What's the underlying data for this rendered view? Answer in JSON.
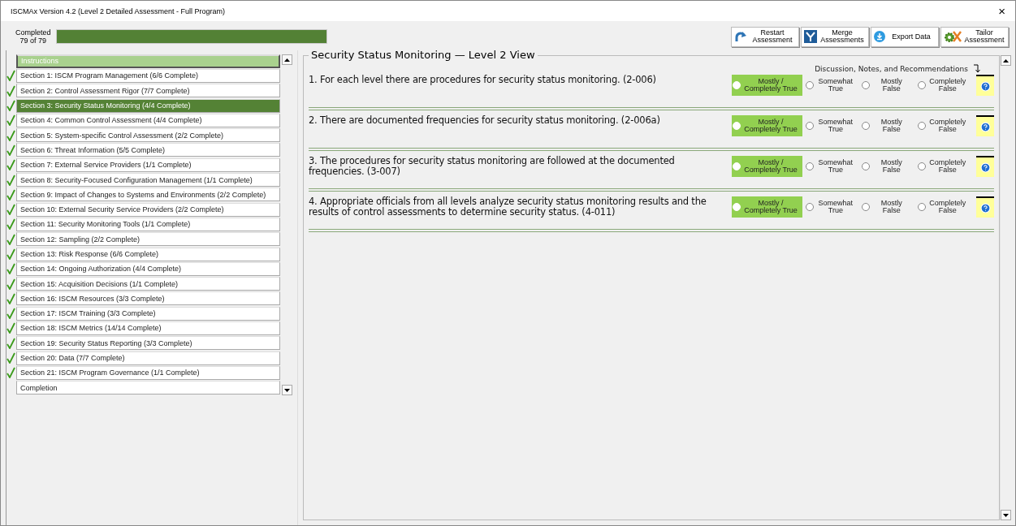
{
  "window": {
    "title": "ISCMAx Version 4.2 (Level 2 Detailed Assessment - Full Program)",
    "close": "×"
  },
  "progress": {
    "label": "Completed",
    "count": "79 of 79",
    "level": 1
  },
  "toolbar": [
    {
      "label": "Restart Assessment",
      "kind": "restart"
    },
    {
      "label": "Merge Assessments",
      "kind": "merge"
    },
    {
      "label": "Export Data",
      "kind": "export"
    },
    {
      "label": "Tailor Assessment",
      "kind": "tailor"
    }
  ],
  "sidebar": {
    "items": [
      {
        "label": "Instructions",
        "checked": false,
        "selected": false,
        "focused": true
      },
      {
        "label": "Section 1: ISCM Program Management (6/6 Complete)",
        "checked": true,
        "selected": false,
        "focused": false
      },
      {
        "label": "Section 2: Control Assessment Rigor (7/7 Complete)",
        "checked": true,
        "selected": false,
        "focused": false
      },
      {
        "label": "Section 3: Security Status Monitoring (4/4 Complete)",
        "checked": true,
        "selected": true,
        "focused": false
      },
      {
        "label": "Section 4: Common Control Assessment (4/4 Complete)",
        "checked": true,
        "selected": false,
        "focused": false
      },
      {
        "label": "Section 5: System-specific Control Assessment (2/2 Complete)",
        "checked": true,
        "selected": false,
        "focused": false
      },
      {
        "label": "Section 6: Threat Information (5/5 Complete)",
        "checked": true,
        "selected": false,
        "focused": false
      },
      {
        "label": "Section 7: External Service Providers (1/1 Complete)",
        "checked": true,
        "selected": false,
        "focused": false
      },
      {
        "label": "Section 8: Security-Focused Configuration Management (1/1 Complete)",
        "checked": true,
        "selected": false,
        "focused": false
      },
      {
        "label": "Section 9: Impact of Changes to Systems and Environments (2/2 Complete)",
        "checked": true,
        "selected": false,
        "focused": false
      },
      {
        "label": "Section 10: External Security Service Providers (2/2 Complete)",
        "checked": true,
        "selected": false,
        "focused": false
      },
      {
        "label": "Section 11: Security Monitoring Tools (1/1 Complete)",
        "checked": true,
        "selected": false,
        "focused": false
      },
      {
        "label": "Section 12: Sampling (2/2 Complete)",
        "checked": true,
        "selected": false,
        "focused": false
      },
      {
        "label": "Section 13: Risk Response (6/6 Complete)",
        "checked": true,
        "selected": false,
        "focused": false
      },
      {
        "label": "Section 14: Ongoing Authorization (4/4 Complete)",
        "checked": true,
        "selected": false,
        "focused": false
      },
      {
        "label": "Section 15: Acquisition Decisions (1/1 Complete)",
        "checked": true,
        "selected": false,
        "focused": false
      },
      {
        "label": "Section 16: ISCM Resources (3/3 Complete)",
        "checked": true,
        "selected": false,
        "focused": false
      },
      {
        "label": "Section 17: ISCM Training (3/3 Complete)",
        "checked": true,
        "selected": false,
        "focused": false
      },
      {
        "label": "Section 18: ISCM Metrics (14/14 Complete)",
        "checked": true,
        "selected": false,
        "focused": false
      },
      {
        "label": "Section 19: Security Status Reporting (3/3 Complete)",
        "checked": true,
        "selected": false,
        "focused": false
      },
      {
        "label": "Section 20: Data (7/7 Complete)",
        "checked": true,
        "selected": false,
        "focused": false
      },
      {
        "label": "Section 21: ISCM Program Governance (1/1 Complete)",
        "checked": true,
        "selected": false,
        "focused": false
      },
      {
        "label": "Completion",
        "checked": false,
        "selected": false,
        "focused": false
      }
    ]
  },
  "main": {
    "title": "Security Status Monitoring — Level 2 View",
    "notes_header": "Discussion, Notes, and Recommendations",
    "questions": [
      {
        "text": "1. For each level there are procedures for security status monitoring. (2-006)",
        "options": [
          {
            "label": "Mostly / Completely True",
            "selected": true
          },
          {
            "label": "Somewhat True",
            "selected": false
          },
          {
            "label": "Mostly False",
            "selected": false
          },
          {
            "label": "Completely False",
            "selected": false
          }
        ]
      },
      {
        "text": "2. There are documented frequencies for security status monitoring. (2-006a)",
        "options": [
          {
            "label": "Mostly / Completely True",
            "selected": true
          },
          {
            "label": "Somewhat True",
            "selected": false
          },
          {
            "label": "Mostly False",
            "selected": false
          },
          {
            "label": "Completely False",
            "selected": false
          }
        ]
      },
      {
        "text": "3. The procedures for security status monitoring are followed at the documented frequencies. (3-007)",
        "options": [
          {
            "label": "Mostly / Completely True",
            "selected": true
          },
          {
            "label": "Somewhat True",
            "selected": false
          },
          {
            "label": "Mostly False",
            "selected": false
          },
          {
            "label": "Completely False",
            "selected": false
          }
        ]
      },
      {
        "text": "4. Appropriate officials from all levels analyze security status monitoring results and the results of control assessments to determine security status. (4-011)",
        "options": [
          {
            "label": "Mostly / Completely True",
            "selected": true
          },
          {
            "label": "Somewhat True",
            "selected": false
          },
          {
            "label": "Mostly False",
            "selected": false
          },
          {
            "label": "Completely False",
            "selected": false
          }
        ]
      }
    ]
  }
}
